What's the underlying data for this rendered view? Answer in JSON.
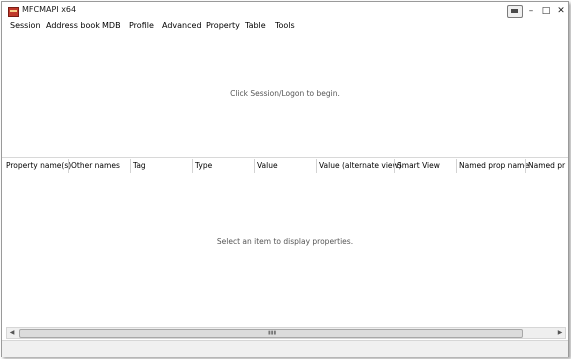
{
  "window": {
    "title": "MFCMAPI x64"
  },
  "menu": [
    "Session",
    "Address book",
    "MDB",
    "Profile",
    "Advanced",
    "Property",
    "Table",
    "Tools"
  ],
  "top_pane": {
    "message": "Click Session/Logon to begin."
  },
  "columns": [
    "Property name(s)",
    "Other names",
    "Tag",
    "Type",
    "Value",
    "Value (alternate view)",
    "Smart View",
    "Named prop name",
    "Named pr"
  ],
  "bottom_pane": {
    "message": "Select an item to display properties."
  },
  "icons": {
    "close": "close-icon",
    "minimize": "minimize-icon",
    "maximize": "maximize-icon",
    "app": "mfcmapi-app-icon"
  },
  "colors": {
    "app_icon": "#c0392b"
  }
}
